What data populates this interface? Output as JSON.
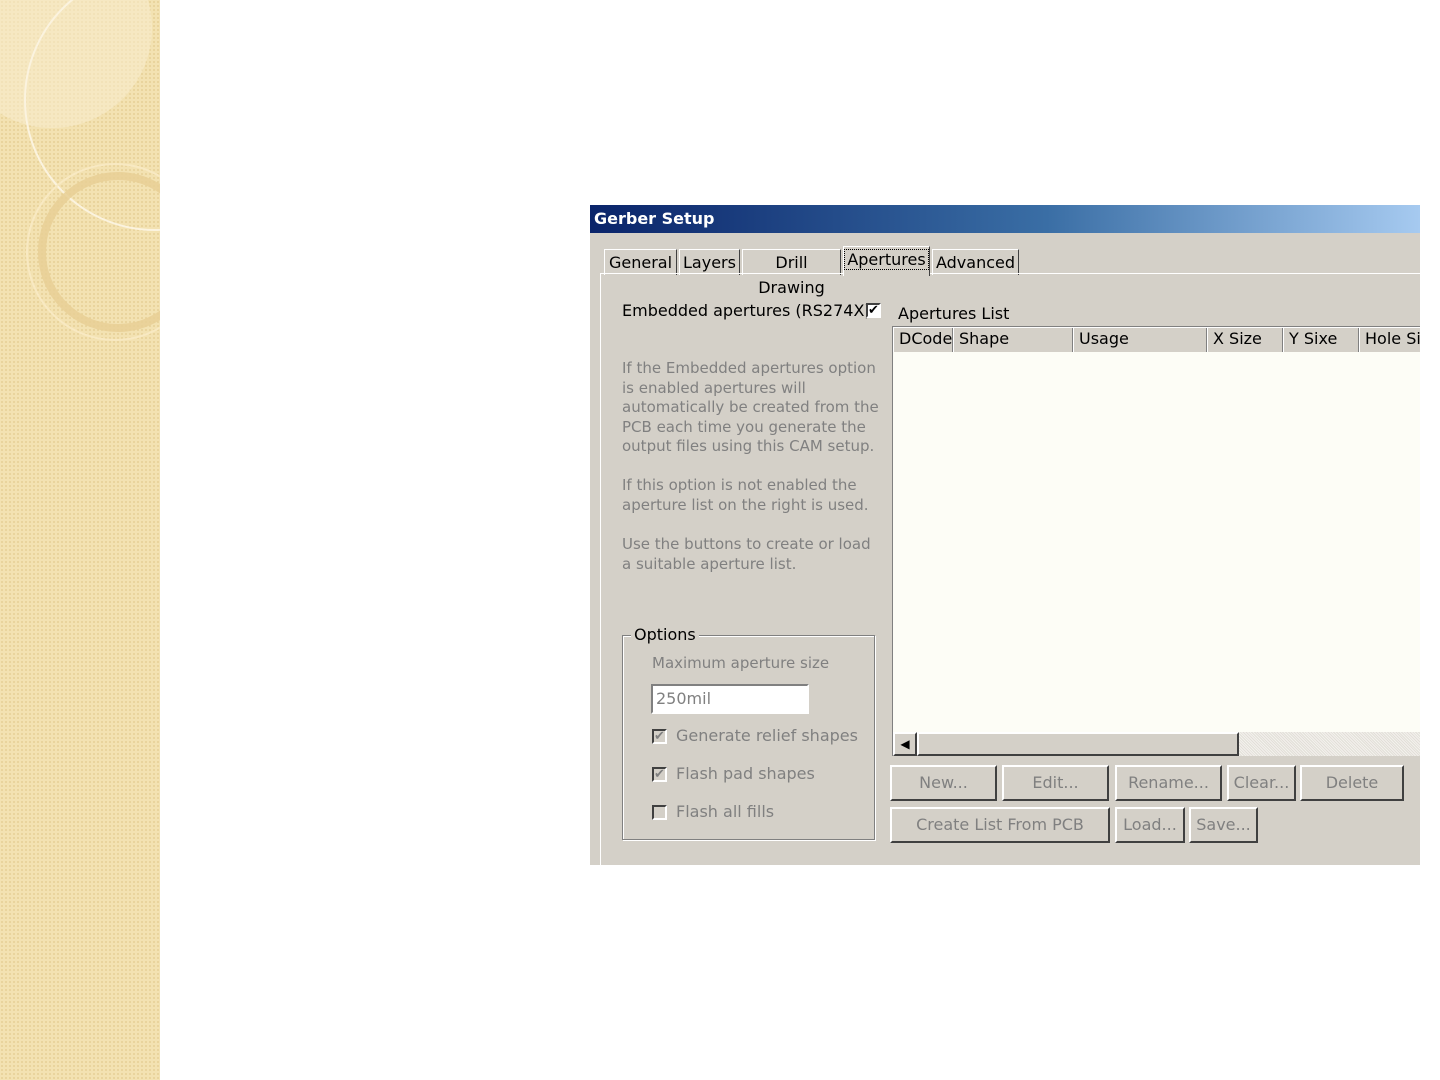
{
  "window": {
    "title": "Gerber Setup"
  },
  "tabs": [
    {
      "label": "General"
    },
    {
      "label": "Layers"
    },
    {
      "label": "Drill Drawing"
    },
    {
      "label": "Apertures",
      "active": true
    },
    {
      "label": "Advanced"
    }
  ],
  "embedded": {
    "label": "Embedded apertures (RS274X)",
    "checked": true
  },
  "description": {
    "p1": "If the Embedded apertures option is enabled apertures will automatically be created from the PCB each time you generate the output files using this CAM setup.",
    "p2": "If this option is not enabled the aperture list on the right is used.",
    "p3": "Use the buttons to create or load a suitable aperture list."
  },
  "options": {
    "legend": "Options",
    "max_label": "Maximum aperture size",
    "max_value": "250mil",
    "relief_label": "Generate relief shapes",
    "relief_checked": true,
    "flash_pad_label": "Flash pad shapes",
    "flash_pad_checked": true,
    "flash_fills_label": "Flash all fills",
    "flash_fills_checked": false
  },
  "apertures_list": {
    "title": "Apertures List",
    "columns": [
      "DCode",
      "Shape",
      "Usage",
      "X Size",
      "Y Sixe",
      "Hole Siz"
    ]
  },
  "buttons": {
    "new": "New...",
    "edit": "Edit...",
    "rename": "Rename...",
    "clear": "Clear...",
    "delete": "Delete",
    "create": "Create List From PCB",
    "load": "Load...",
    "save": "Save..."
  },
  "icons": {
    "check": "✔",
    "scroll_left": "◀"
  },
  "colors": {
    "title_start": "#0a246a",
    "title_end": "#a6caf0",
    "dialog_face": "#d4d0c8",
    "sidebar": "#f3e2b2"
  }
}
